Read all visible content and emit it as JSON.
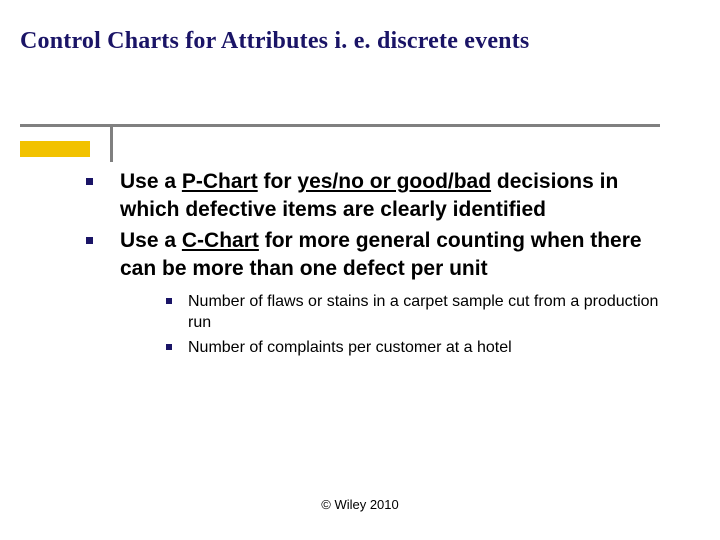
{
  "title": "Control Charts for Attributes i. e. discrete events",
  "bullets": {
    "b1": {
      "t1": "Use a ",
      "u1": "P-Chart",
      "t2": " for ",
      "u2": "yes/no or good/bad",
      "t3": " decisions in which defective items are clearly identified"
    },
    "b2": {
      "t1": "Use a ",
      "u1": "C-Chart",
      "t2": " for more general counting when there can be more than one defect per unit"
    }
  },
  "sub": {
    "s1": "Number of flaws or stains in a carpet sample cut from a production run",
    "s2": "Number of complaints per customer at a hotel"
  },
  "footer": "© Wiley 2010"
}
